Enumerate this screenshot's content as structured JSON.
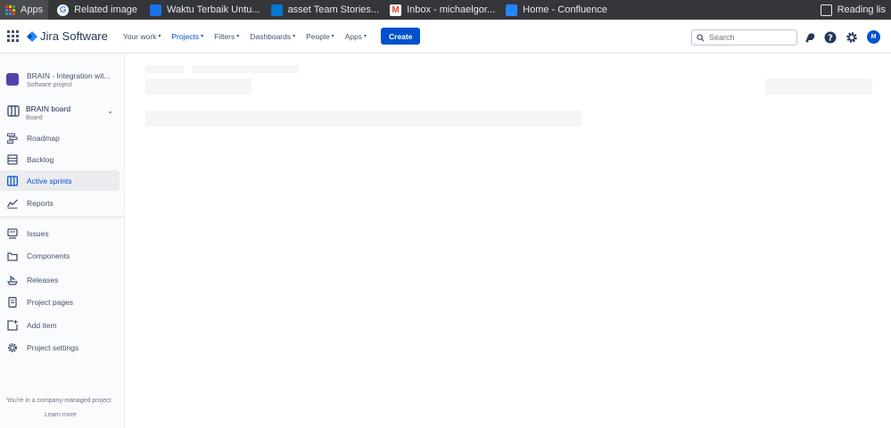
{
  "bookmarks": [
    {
      "label": "Apps",
      "icon": "apps-grid-icon"
    },
    {
      "label": "Related image",
      "icon": "google-icon"
    },
    {
      "label": "Waktu Terbaik Untu...",
      "icon": "bookmark-icon"
    },
    {
      "label": "asset Team Stories...",
      "icon": "azure-devops-icon"
    },
    {
      "label": "Inbox - michaelgor...",
      "icon": "gmail-icon"
    },
    {
      "label": "Home - Confluence",
      "icon": "confluence-icon"
    }
  ],
  "reading_list": "Reading lis",
  "topnav": {
    "product": "Jira Software",
    "items": [
      "Your work",
      "Projects",
      "Filters",
      "Dashboards",
      "People",
      "Apps"
    ],
    "create": "Create",
    "search_placeholder": "Search",
    "avatar_initial": "M"
  },
  "sidebar": {
    "project_name": "BRAIN - Integration wit...",
    "project_type": "Software project",
    "board_name": "BRAIN board",
    "board_type": "Board",
    "planning": [
      "Roadmap",
      "Backlog",
      "Active sprints",
      "Reports"
    ],
    "development": [
      "Issues",
      "Components",
      "Releases",
      "Project pages",
      "Add item",
      "Project settings"
    ],
    "footer_text": "You're in a company-managed project",
    "learn_more": "Learn more"
  },
  "colors": {
    "accent": "#0052cc",
    "bookmark_bar": "#35363a",
    "skeleton": "#f4f5f7"
  }
}
